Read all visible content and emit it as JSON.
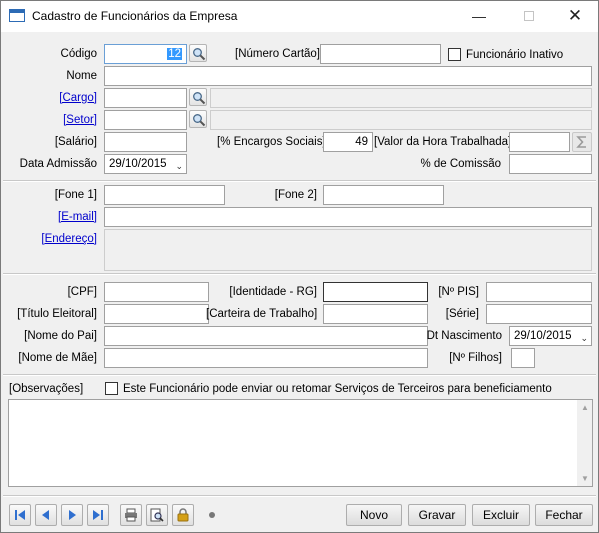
{
  "window": {
    "title": "Cadastro de Funcionários da Empresa",
    "controls": {
      "minimize": "—",
      "close": "✕"
    }
  },
  "form": {
    "codigo": {
      "label": "Código",
      "value": "12"
    },
    "numero_cartao": {
      "label": "[Número Cartão]",
      "value": ""
    },
    "funcionario_inativo": {
      "label": "Funcionário Inativo",
      "checked": false
    },
    "nome": {
      "label": "Nome",
      "value": ""
    },
    "cargo": {
      "label": "[Cargo]",
      "value": "",
      "description": ""
    },
    "setor": {
      "label": "[Setor]",
      "value": "",
      "description": ""
    },
    "salario": {
      "label": "[Salário]",
      "value": ""
    },
    "encargos_sociais": {
      "label": "[% Encargos Sociais]",
      "value": "49"
    },
    "valor_hora": {
      "label": "[Valor da Hora Trabalhada]",
      "value": ""
    },
    "data_admissao": {
      "label": "Data Admissão",
      "value": "29/10/2015"
    },
    "comissao": {
      "label": "% de Comissão",
      "value": ""
    },
    "fone1": {
      "label": "[Fone 1]",
      "value": ""
    },
    "fone2": {
      "label": "[Fone 2]",
      "value": ""
    },
    "email": {
      "label": "[E-mail]",
      "value": ""
    },
    "endereco": {
      "label": "[Endereço]",
      "value": ""
    },
    "cpf": {
      "label": "[CPF]",
      "value": ""
    },
    "identidade": {
      "label": "[Identidade - RG]",
      "value": ""
    },
    "pis": {
      "label": "[Nº PIS]",
      "value": ""
    },
    "titulo_eleitoral": {
      "label": "[Título Eleitoral]",
      "value": ""
    },
    "carteira_trabalho": {
      "label": "[Carteira de Trabalho]",
      "value": ""
    },
    "serie": {
      "label": "[Série]",
      "value": ""
    },
    "nome_pai": {
      "label": "[Nome do Pai]",
      "value": ""
    },
    "dt_nascimento": {
      "label": "Dt Nascimento",
      "value": "29/10/2015"
    },
    "nome_mae": {
      "label": "[Nome de Mãe]",
      "value": ""
    },
    "filhos": {
      "label": "[Nº Filhos]",
      "value": ""
    },
    "observacoes": {
      "label": "[Observações]",
      "value": ""
    },
    "servicos_terceiros": {
      "label": "Este Funcionário pode enviar ou retomar Serviços de Terceiros para beneficiamento",
      "checked": false
    }
  },
  "toolbar": {
    "nav_icons": [
      "first-record-icon",
      "previous-record-icon",
      "next-record-icon",
      "last-record-icon"
    ],
    "tool_icons": [
      "printer-icon",
      "print-preview-icon",
      "lock-icon"
    ],
    "buttons": {
      "novo": "Novo",
      "gravar": "Gravar",
      "excluir": "Excluir",
      "fechar": "Fechar"
    }
  },
  "colors": {
    "nav_blue": "#2f6fcf",
    "link": "#0000cc",
    "selection": "#3399ff",
    "lock_gold": "#d4a017"
  }
}
